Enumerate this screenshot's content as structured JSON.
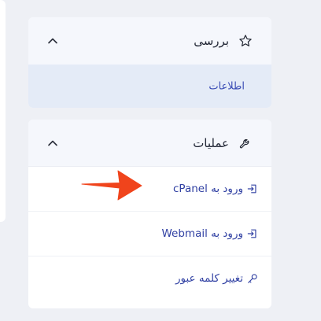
{
  "review": {
    "title": "بررسی",
    "icon": "star-icon",
    "items": [
      {
        "label": "اطلاعات",
        "selected": true
      }
    ]
  },
  "operations": {
    "title": "عملیات",
    "icon": "wrench-icon",
    "items": [
      {
        "label": "ورود به cPanel",
        "icon": "login-icon"
      },
      {
        "label": "ورود به Webmail",
        "icon": "login-icon"
      },
      {
        "label": "تغییر کلمه عبور",
        "icon": "key-icon"
      }
    ]
  },
  "colors": {
    "accent": "#3141a3",
    "header_bg": "#f5f7fc",
    "selected_bg": "#e4ebf7",
    "annotation_arrow": "#f0441c"
  }
}
